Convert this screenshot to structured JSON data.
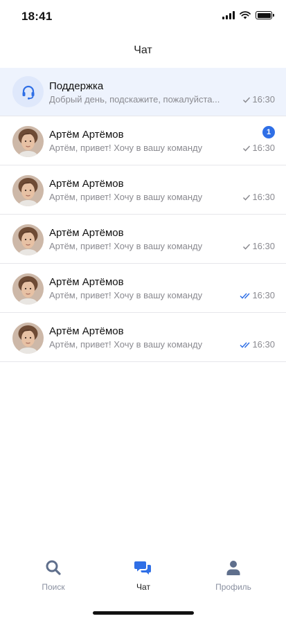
{
  "status_bar": {
    "time": "18:41"
  },
  "header": {
    "title": "Чат"
  },
  "chats": [
    {
      "name": "Поддержка",
      "preview": "Добрый день, подскажите, пожалуйста...",
      "time": "16:30",
      "read_status": "sent",
      "unread": null,
      "avatar": "headset-icon"
    },
    {
      "name": "Артём Артёмов",
      "preview": "Артём, привет! Хочу в вашу команду",
      "time": "16:30",
      "read_status": "sent",
      "unread": "1",
      "avatar": "user-photo"
    },
    {
      "name": "Артём Артёмов",
      "preview": "Артём, привет! Хочу в вашу команду",
      "time": "16:30",
      "read_status": "sent",
      "unread": null,
      "avatar": "user-photo"
    },
    {
      "name": "Артём Артёмов",
      "preview": "Артём, привет! Хочу в вашу команду",
      "time": "16:30",
      "read_status": "sent",
      "unread": null,
      "avatar": "user-photo"
    },
    {
      "name": "Артём Артёмов",
      "preview": "Артём, привет! Хочу в вашу команду",
      "time": "16:30",
      "read_status": "read",
      "unread": null,
      "avatar": "user-photo"
    },
    {
      "name": "Артём Артёмов",
      "preview": "Артём, привет! Хочу в вашу команду",
      "time": "16:30",
      "read_status": "read",
      "unread": null,
      "avatar": "user-photo"
    }
  ],
  "tabs": [
    {
      "label": "Поиск",
      "icon": "search-icon",
      "active": false
    },
    {
      "label": "Чат",
      "icon": "chat-icon",
      "active": true
    },
    {
      "label": "Профиль",
      "icon": "profile-icon",
      "active": false
    }
  ],
  "colors": {
    "accent": "#2f6fe6",
    "support_bg": "#eef3fd",
    "muted": "#8a8a90"
  }
}
